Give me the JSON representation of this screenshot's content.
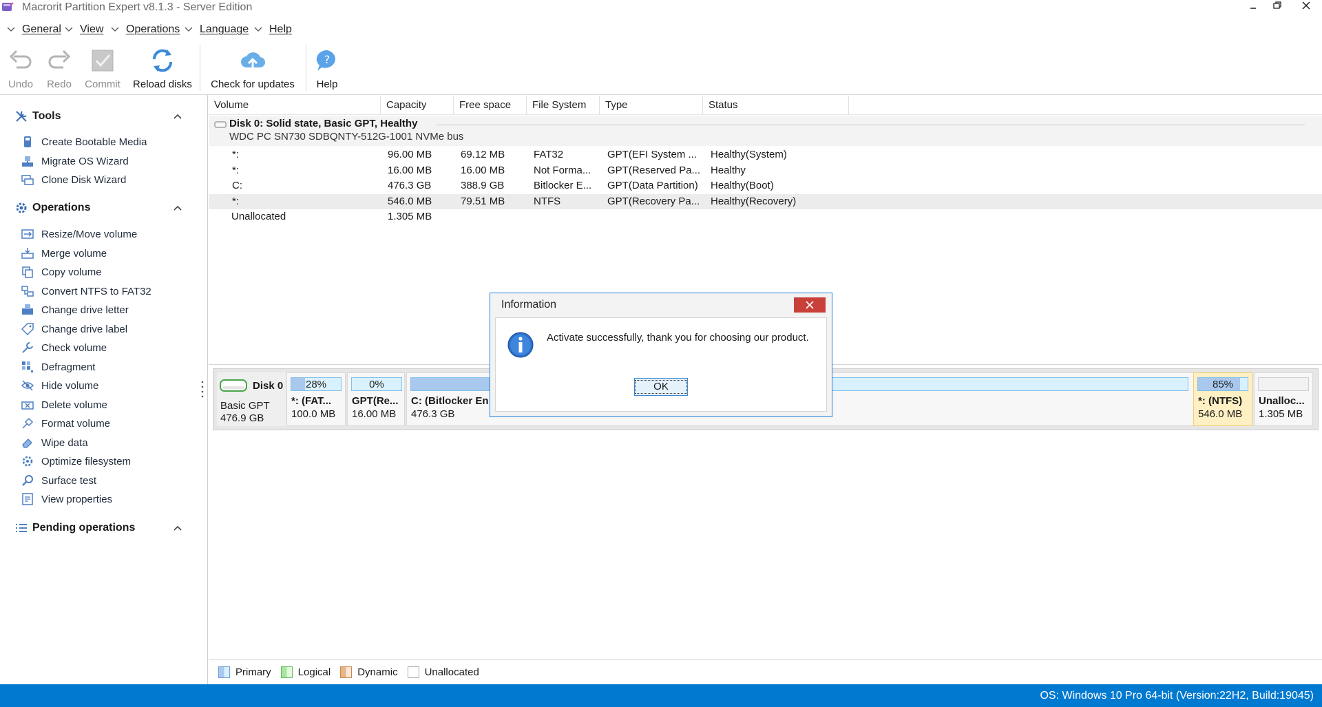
{
  "window": {
    "title": "Macrorit Partition Expert v8.1.3 - Server Edition",
    "minimize_icon": "minimize-icon",
    "restore_icon": "restore-icon",
    "close_icon": "close-icon"
  },
  "menu": [
    {
      "label": "General"
    },
    {
      "label": "View"
    },
    {
      "label": "Operations"
    },
    {
      "label": "Language"
    },
    {
      "label": "Help"
    }
  ],
  "toolbar": {
    "undo": "Undo",
    "redo": "Redo",
    "commit": "Commit",
    "reload": "Reload disks",
    "updates": "Check for updates",
    "help": "Help"
  },
  "sidebar": {
    "tools": {
      "title": "Tools",
      "items": [
        "Create Bootable Media",
        "Migrate OS Wizard",
        "Clone Disk Wizard"
      ]
    },
    "operations": {
      "title": "Operations",
      "items": [
        "Resize/Move volume",
        "Merge volume",
        "Copy volume",
        "Convert NTFS to FAT32",
        "Change drive letter",
        "Change drive label",
        "Check volume",
        "Defragment",
        "Hide volume",
        "Delete volume",
        "Format volume",
        "Wipe data",
        "Optimize filesystem",
        "Surface test",
        "View properties"
      ]
    },
    "pending": {
      "title": "Pending operations"
    }
  },
  "volume_list": {
    "columns": [
      "Volume",
      "Capacity",
      "Free space",
      "File System",
      "Type",
      "Status"
    ],
    "disk": {
      "name": "Disk 0: Solid state, Basic GPT, Healthy",
      "model": "WDC PC SN730 SDBQNTY-512G-1001 NVMe bus"
    },
    "rows": [
      {
        "volume": "*:",
        "capacity": "96.00 MB",
        "free": "69.12 MB",
        "fs": "FAT32",
        "type": "GPT(EFI System ...",
        "status": "Healthy(System)"
      },
      {
        "volume": "*:",
        "capacity": "16.00 MB",
        "free": "16.00 MB",
        "fs": "Not Forma...",
        "type": "GPT(Reserved Pa...",
        "status": "Healthy"
      },
      {
        "volume": "C:",
        "capacity": "476.3 GB",
        "free": "388.9 GB",
        "fs": "Bitlocker E...",
        "type": "GPT(Data Partition)",
        "status": "Healthy(Boot)"
      },
      {
        "volume": "*:",
        "capacity": "546.0 MB",
        "free": "79.51 MB",
        "fs": "NTFS",
        "type": "GPT(Recovery Pa...",
        "status": "Healthy(Recovery)"
      },
      {
        "volume": "Unallocated",
        "capacity": "1.305 MB",
        "free": "",
        "fs": "",
        "type": "",
        "status": ""
      }
    ]
  },
  "disk_map": {
    "disk_name": "Disk 0",
    "disk_type": "Basic GPT",
    "disk_size": "476.9 GB",
    "partitions": [
      {
        "pct_label": "28%",
        "used_fraction": 0.28,
        "label": "*: (FAT...",
        "size": "100.0 MB"
      },
      {
        "pct_label": "0%",
        "used_fraction": 0.0,
        "label": "GPT(Re...",
        "size": "16.00 MB"
      },
      {
        "pct_label": "",
        "used_fraction": 0.18,
        "label": "C: (Bitlocker En",
        "size": "476.3 GB"
      },
      {
        "pct_label": "85%",
        "used_fraction": 0.85,
        "label": "*: (NTFS)",
        "size": "546.0 MB"
      },
      {
        "pct_label": "",
        "used_fraction": 0.0,
        "label": "Unalloc...",
        "size": "1.305 MB"
      }
    ]
  },
  "legend": [
    "Primary",
    "Logical",
    "Dynamic",
    "Unallocated"
  ],
  "status_bar": "OS: Windows 10 Pro 64-bit (Version:22H2, Build:19045)",
  "dialog": {
    "title": "Information",
    "message": "Activate successfully, thank you for choosing our product.",
    "ok": "OK"
  },
  "colors": {
    "accent": "#0079d0",
    "dialog_close": "#c9403a",
    "primary_legend": "#a9c8ee",
    "logical_legend": "#a8e6a0",
    "dynamic_legend": "#e8b48a",
    "selected_partition": "#fff0c4"
  }
}
